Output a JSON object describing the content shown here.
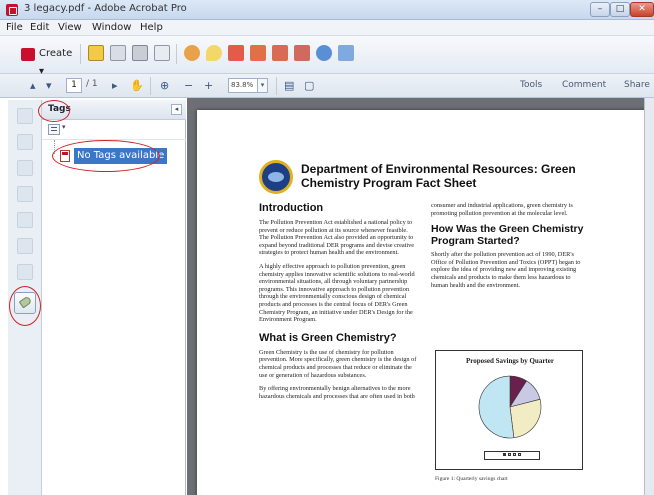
{
  "window": {
    "title": "3 legacy.pdf - Adobe Acrobat Pro",
    "minimize_glyph": "–",
    "maximize_glyph": "□",
    "close_glyph": "✕"
  },
  "menu": [
    "File",
    "Edit",
    "View",
    "Window",
    "Help"
  ],
  "toolbar": {
    "create_label": "Create",
    "create_arrow": "▾",
    "page_current": "1",
    "page_total": "/ 1",
    "zoom": "83.8%",
    "zoom_arrow": "▾",
    "tools": "Tools",
    "comment": "Comment",
    "share": "Share"
  },
  "tags_panel": {
    "title": "Tags",
    "collapse_glyph": "◂",
    "options_arrow": "▾",
    "empty_item": "No Tags available"
  },
  "document": {
    "title": "Department of Environmental Resources: Green Chemistry Program Fact Sheet",
    "sections": {
      "intro_heading": "Introduction",
      "intro_p1": "The Pollution Prevention Act established a national policy to prevent or reduce pollution at its source whenever feasible. The Pollution Prevention Act also provided an opportunity to expand beyond traditional DER programs and devise creative strategies to protect human health and the environment.",
      "intro_p2": "A highly effective approach to pollution prevention, green chemistry applies innovative scientific solutions to real-world environmental situations, all through voluntary partnership programs. This innovative approach to pollution prevention through the environmentally conscious design of chemical products and processes is the central focus of DER's Green Chemistry Program, an initiative under DER's Design for the Environment Program.",
      "what_heading": "What is Green Chemistry?",
      "what_p1": "Green Chemistry is the use of chemistry for pollution prevention. More specifically, green chemistry is the design of chemical products and processes that reduce or eliminate the use or generation of hazardous substances.",
      "what_p2": "By offering environmentally benign alternatives to the more hazardous chemicals and processes that are often used in both",
      "right_p0": "consumer and industrial applications, green chemistry is promoting pollution prevention at the molecular level.",
      "how_heading": "How Was the Green Chemistry Program Started?",
      "how_p1": "Shortly after the pollution prevention act of 1990, DER's Office of Pollution Prevention and Toxics (OPPT) began to explore the idea of providing new and improving existing chemicals and products to make them less hazardous to human health and the environment."
    },
    "figure_caption": "Figure 1: Quarterly savings chart"
  },
  "chart_data": {
    "type": "pie",
    "title": "Proposed Savings by Quarter",
    "legend_placement": "bottom",
    "slices": [
      {
        "value": 9,
        "color": "#6b1f4c"
      },
      {
        "value": 12,
        "color": "#c9c9e6"
      },
      {
        "value": 27,
        "color": "#f2ecc4"
      },
      {
        "value": 52,
        "color": "#bfe6f2"
      }
    ]
  },
  "colors": {
    "selection": "#3b76c7",
    "annotation_red": "#cc2222",
    "doc_bg": "#6e6f74"
  }
}
